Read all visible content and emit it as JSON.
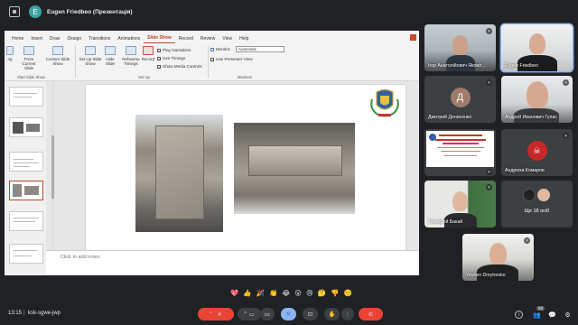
{
  "presenter": {
    "avatar_letter": "E",
    "label": "Eugen Friedbeo (Презентація)"
  },
  "powerpoint": {
    "tabs": [
      "Home",
      "Insert",
      "Draw",
      "Design",
      "Transitions",
      "Animations",
      "Slide Show",
      "Record",
      "Review",
      "View",
      "Help"
    ],
    "active_tab": "Slide Show",
    "ribbon": {
      "from_beginning": "ng",
      "from_current": "From Current Slide",
      "custom_show": "Custom Slide Show",
      "group_start": "Start Slide Show",
      "setup_show": "Set Up Slide Show",
      "hide_slide": "Hide Slide",
      "rehearse": "Rehearse Timings",
      "record": "Record",
      "play_narrations": "Play Narrations",
      "use_timings": "Use Timings",
      "show_media": "Show Media Controls",
      "group_setup": "Set Up",
      "monitor_label": "Monitor:",
      "monitor_value": "Automatic",
      "presenter_view": "Use Presenter View",
      "group_monitors": "Monitors"
    },
    "notes_placeholder": "Click to add notes"
  },
  "participants": [
    {
      "name": "Ігор Анатолійович Яковл...",
      "muted": true,
      "kind": "video"
    },
    {
      "name": "Eugen Friedbeo",
      "muted": false,
      "kind": "video",
      "active": true
    },
    {
      "name": "Дмитрий Денисенко",
      "muted": true,
      "kind": "avatar",
      "letter": "Д"
    },
    {
      "name": "Андрей Ивaнович Гулас",
      "muted": true,
      "kind": "video"
    },
    {
      "name": "",
      "muted": true,
      "kind": "screen"
    },
    {
      "name": "Андрюха Комаров",
      "muted": true,
      "kind": "avatar"
    },
    {
      "name": "Тимофей Бакай",
      "muted": true,
      "kind": "video"
    },
    {
      "name": "Ще 18 осіб",
      "muted": false,
      "kind": "more"
    },
    {
      "name": "Yevhen Dmytrenko",
      "muted": true,
      "kind": "video"
    }
  ],
  "bottom": {
    "time": "13:15",
    "separator": "|",
    "meeting_code": "ksk-sgwe-jwp",
    "participants_count": "20"
  },
  "reactions": [
    "💖",
    "👍",
    "🎉",
    "👏",
    "😂",
    "😮",
    "😢",
    "🤔",
    "👎",
    "🙂"
  ],
  "icons": {
    "up_arrow": "^",
    "mic_off": "✕",
    "camera": "▭",
    "captions": "CC",
    "emoji": "☺",
    "present": "⊡",
    "raise_hand": "✋",
    "more": "⋮",
    "leave": "✆",
    "info": "i",
    "people": "👥",
    "chat": "💬",
    "activities": "⚙"
  },
  "colors": {
    "background": "#202124",
    "leave_red": "#ea4335",
    "active_blue": "#8ab4f8",
    "ppt_accent": "#b7472a"
  }
}
